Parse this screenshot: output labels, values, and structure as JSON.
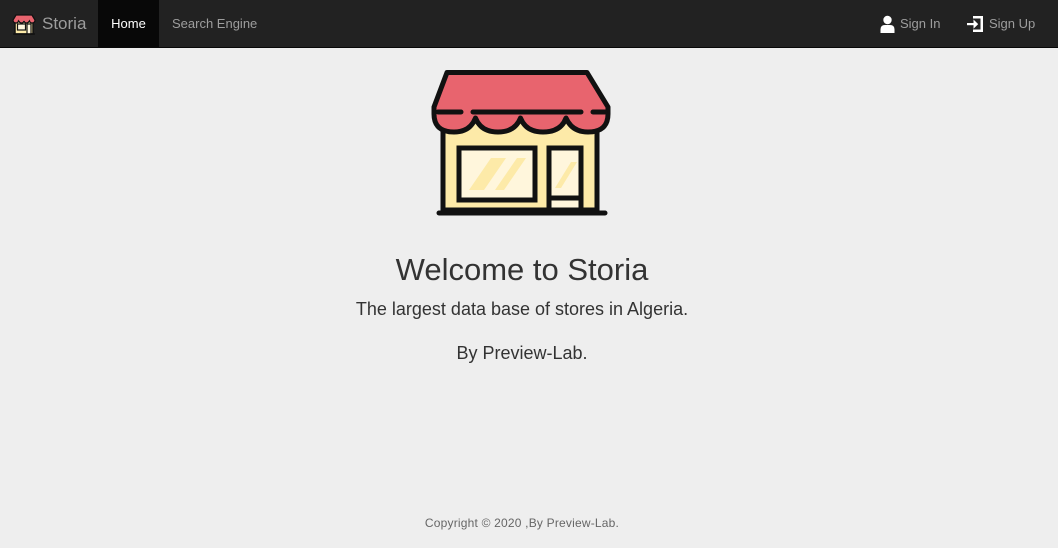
{
  "navbar": {
    "brand": "Storia",
    "brand_icon": "store-icon",
    "links": {
      "home": "Home",
      "search": "Search Engine",
      "sign_in": "Sign In",
      "sign_up": "Sign Up"
    },
    "icons": {
      "sign_in": "user-icon",
      "sign_up": "log-in-icon"
    },
    "colors": {
      "background": "#222222",
      "active_background": "#080808",
      "text": "#9d9d9d",
      "active_text": "#ffffff"
    }
  },
  "hero": {
    "image_icon": "storefront-icon",
    "title": "Welcome to Storia",
    "subtitle": "The largest data base of stores in Algeria.",
    "byline": "By Preview-Lab."
  },
  "footer": {
    "copyright": "Copyright © 2020 ,By Preview-Lab."
  },
  "colors": {
    "page_background": "#eeeeee",
    "awning_red": "#e8646e",
    "wall_yellow": "#fdeaa8",
    "window_fill": "#fff6dc",
    "outline": "#111111"
  }
}
